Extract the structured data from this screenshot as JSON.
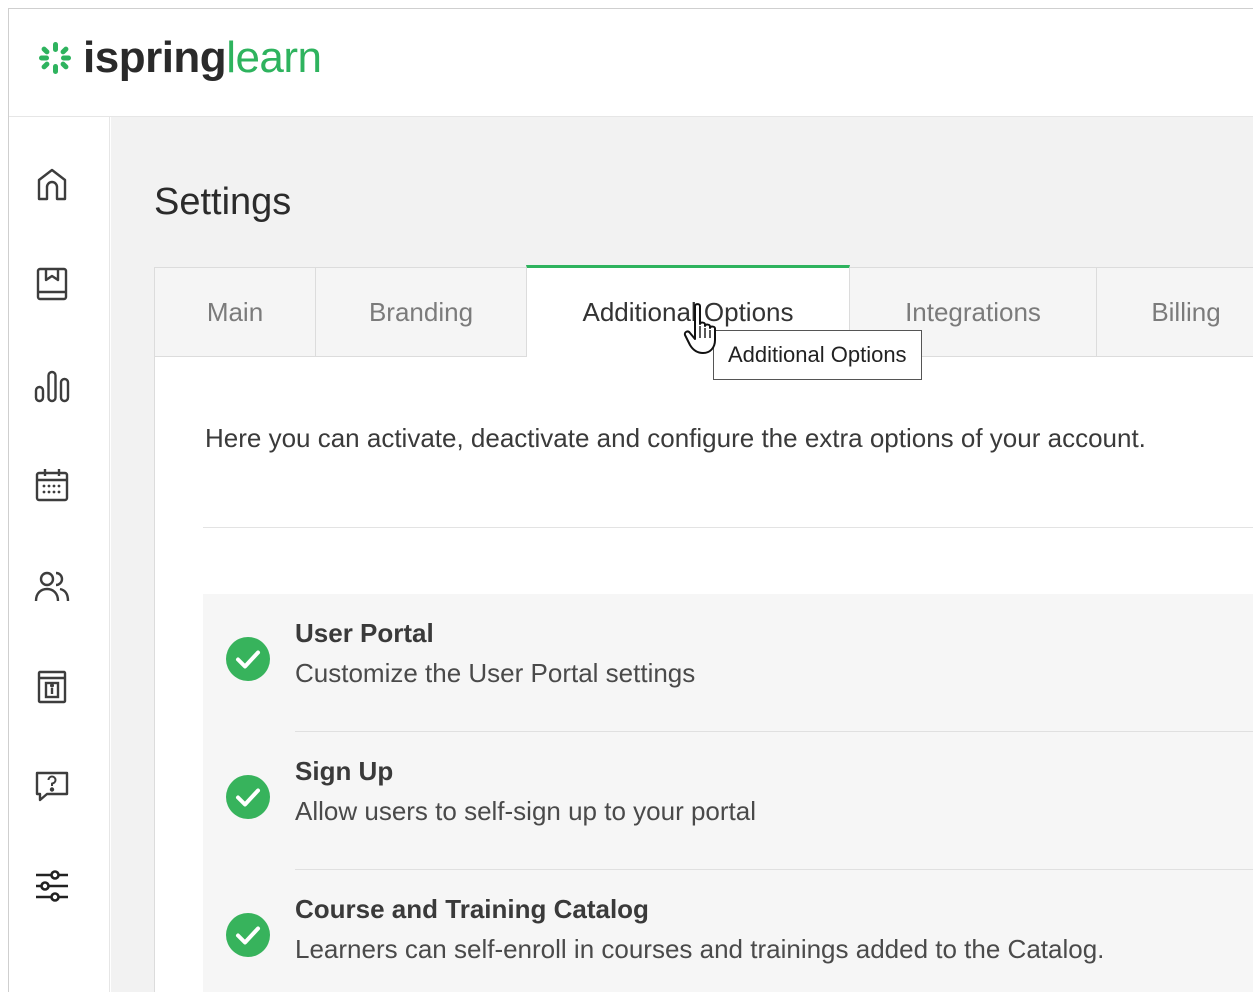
{
  "app": {
    "logo_part1": "ispring",
    "logo_part2": "learn",
    "brand_color": "#2eb35e"
  },
  "sidebar": {
    "items": [
      {
        "icon": "home-icon"
      },
      {
        "icon": "book-icon"
      },
      {
        "icon": "bar-chart-icon"
      },
      {
        "icon": "calendar-icon"
      },
      {
        "icon": "users-icon"
      },
      {
        "icon": "info-card-icon"
      },
      {
        "icon": "help-chat-icon"
      },
      {
        "icon": "settings-sliders-icon",
        "active": true
      }
    ]
  },
  "page": {
    "title": "Settings"
  },
  "tabs": [
    {
      "label": "Main"
    },
    {
      "label": "Branding"
    },
    {
      "label": "Additional Options",
      "active": true
    },
    {
      "label": "Integrations"
    },
    {
      "label": "Billing"
    }
  ],
  "tooltip": {
    "text": "Additional Options"
  },
  "panel": {
    "intro": "Here you can activate, deactivate and configure the extra options of your account."
  },
  "options": [
    {
      "title": "User Portal",
      "description": "Customize the User Portal settings",
      "enabled": true
    },
    {
      "title": "Sign Up",
      "description": "Allow users to self-sign up to your portal",
      "enabled": true
    },
    {
      "title": "Course and Training Catalog",
      "description": "Learners can self-enroll in courses and trainings added to the Catalog.",
      "enabled": true
    }
  ]
}
